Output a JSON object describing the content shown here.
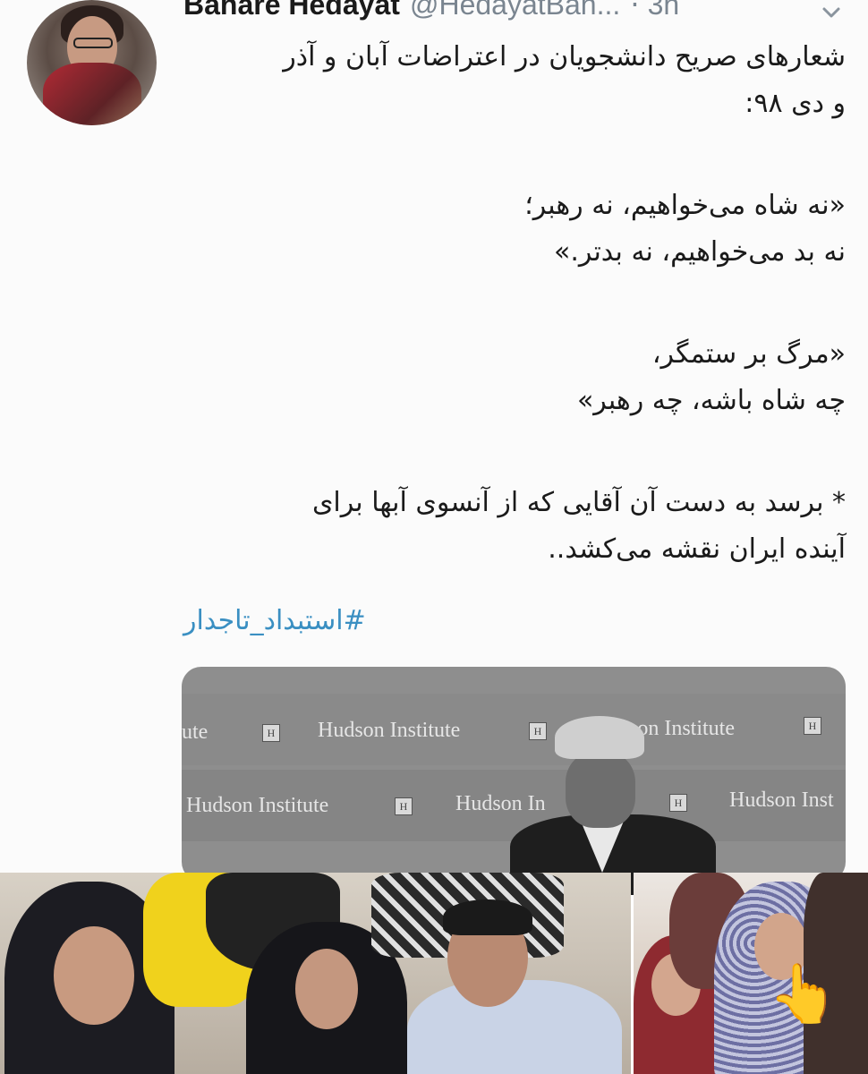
{
  "tweet": {
    "display_name": "Bahare Hedayat",
    "handle": "@HedayatBah...",
    "separator": "·",
    "time": "3h",
    "lines": [
      "شعارهای صریح دانشجویان در اعتراضات آبان و آذر",
      "و دی ۹۸:",
      "«نه شاه می‌خواهیم، نه رهبر؛",
      "نه بد می‌خواهیم، نه بدتر.»",
      "«مرگ بر ستمگر،",
      "چه شاه باشه، چه رهبر»",
      "* برسد به دست آن آقایی که از آنسوی آبها برای",
      "آینده ایران نقشه می‌کشد.."
    ],
    "hashtag": "#استبداد_تاجدار"
  },
  "media": {
    "backdrop_text": "Hudson Institute",
    "backdrop_text_partial_1": "ute",
    "backdrop_text_partial_2": "Hudson In",
    "backdrop_text_partial_3": "Hudson Inst",
    "backdrop_text_partial_4": "son Institute",
    "logo_mark": "H"
  },
  "bottom": {
    "emoji": "👆"
  },
  "colors": {
    "handle_gray": "#7a8590",
    "hashtag_blue": "#3a8fc2"
  },
  "icons": [
    "chevron-down-icon"
  ]
}
